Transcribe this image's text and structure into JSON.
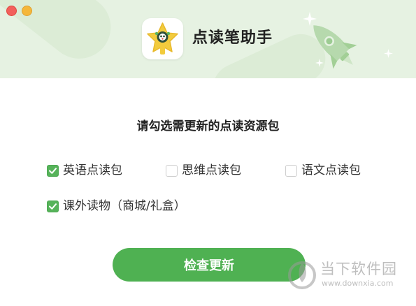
{
  "window": {
    "controls": [
      "close-button",
      "minimize-button"
    ]
  },
  "header": {
    "app_name": "点读笔助手",
    "logo_icon": "star-cartoon-logo-icon",
    "decoration_icon": "rocket-icon"
  },
  "main": {
    "prompt": "请勾选需更新的点读资源包",
    "options": [
      {
        "label": "英语点读包",
        "checked": true
      },
      {
        "label": "思维点读包",
        "checked": false
      },
      {
        "label": "语文点读包",
        "checked": false
      },
      {
        "label": "课外读物（商城/礼盒）",
        "checked": true
      }
    ],
    "check_button_label": "检查更新"
  },
  "watermark": {
    "name": "当下软件园",
    "url": "www.downxia.com"
  },
  "colors": {
    "header_bg": "#e6f2e2",
    "accent_green": "#4fb152",
    "logo_yellow": "#f2cb3d",
    "close": "#f2605c",
    "minimize": "#f5b73b"
  }
}
